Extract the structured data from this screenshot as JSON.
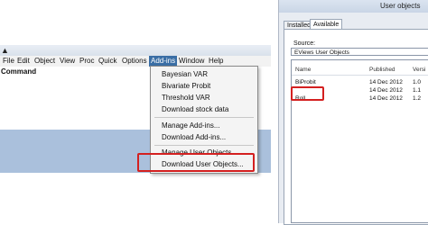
{
  "menubar": {
    "items": [
      "File",
      "Edit",
      "Object",
      "View",
      "Proc",
      "Quick",
      "Options",
      "Add-ins",
      "Window",
      "Help"
    ]
  },
  "command_label": "Command",
  "addins_menu": {
    "items": [
      "Bayesian VAR",
      "Bivariate Probit",
      "Threshold VAR",
      "Download stock data",
      "Manage Add-ins...",
      "Download Add-ins...",
      "Manage User Objects...",
      "Download User Objects..."
    ]
  },
  "user_objects_dialog": {
    "title": "User objects",
    "tabs": [
      "Installed",
      "Available"
    ],
    "source_label": "Source:",
    "source_value": "EViews User Objects",
    "columns": [
      "Name",
      "Published",
      "Versi"
    ],
    "rows": [
      {
        "name": "BiProbit",
        "published": "14 Dec 2012",
        "version": "1.0"
      },
      {
        "name": "",
        "published": "14 Dec 2012",
        "version": "1.1"
      },
      {
        "name": "Roll",
        "published": "14 Dec 2012",
        "version": "1.2"
      }
    ]
  },
  "colors": {
    "highlight_box": "#d42020",
    "menu_selected": "#3a6ea5",
    "workarea": "#aac0dc"
  }
}
